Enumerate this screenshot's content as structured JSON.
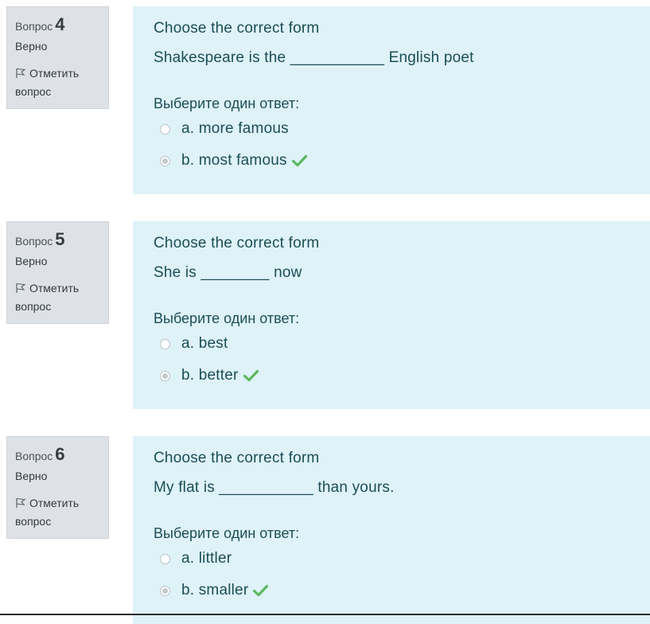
{
  "questions": [
    {
      "label": "Вопрос",
      "number": "4",
      "state": "Верно",
      "flag_label": "Отметить вопрос",
      "title": "Choose the correct form",
      "text": "Shakespeare is the ___________ English poet",
      "prompt": "Выберите один ответ:",
      "answers": [
        {
          "label": "a. more famous",
          "selected": false,
          "correct": false
        },
        {
          "label": "b. most famous",
          "selected": true,
          "correct": true
        }
      ]
    },
    {
      "label": "Вопрос",
      "number": "5",
      "state": "Верно",
      "flag_label": "Отметить вопрос",
      "title": "Choose the correct form",
      "text": "She is ________ now",
      "prompt": "Выберите один ответ:",
      "answers": [
        {
          "label": "a. best",
          "selected": false,
          "correct": false
        },
        {
          "label": "b. better",
          "selected": true,
          "correct": true
        }
      ]
    },
    {
      "label": "Вопрос",
      "number": "6",
      "state": "Верно",
      "flag_label": "Отметить вопрос",
      "title": "Choose the correct form",
      "text": "My flat is ___________ than yours.",
      "prompt": "Выберите один ответ:",
      "answers": [
        {
          "label": "a. littler",
          "selected": false,
          "correct": false
        },
        {
          "label": "b. smaller",
          "selected": true,
          "correct": true
        }
      ]
    }
  ],
  "icons": {
    "flag": "flag-icon",
    "correct": "check-icon"
  },
  "colors": {
    "content_bg": "#def2f8",
    "info_bg": "#dee2e6",
    "correct": "#5cb85c",
    "text": "#1c4d57"
  }
}
